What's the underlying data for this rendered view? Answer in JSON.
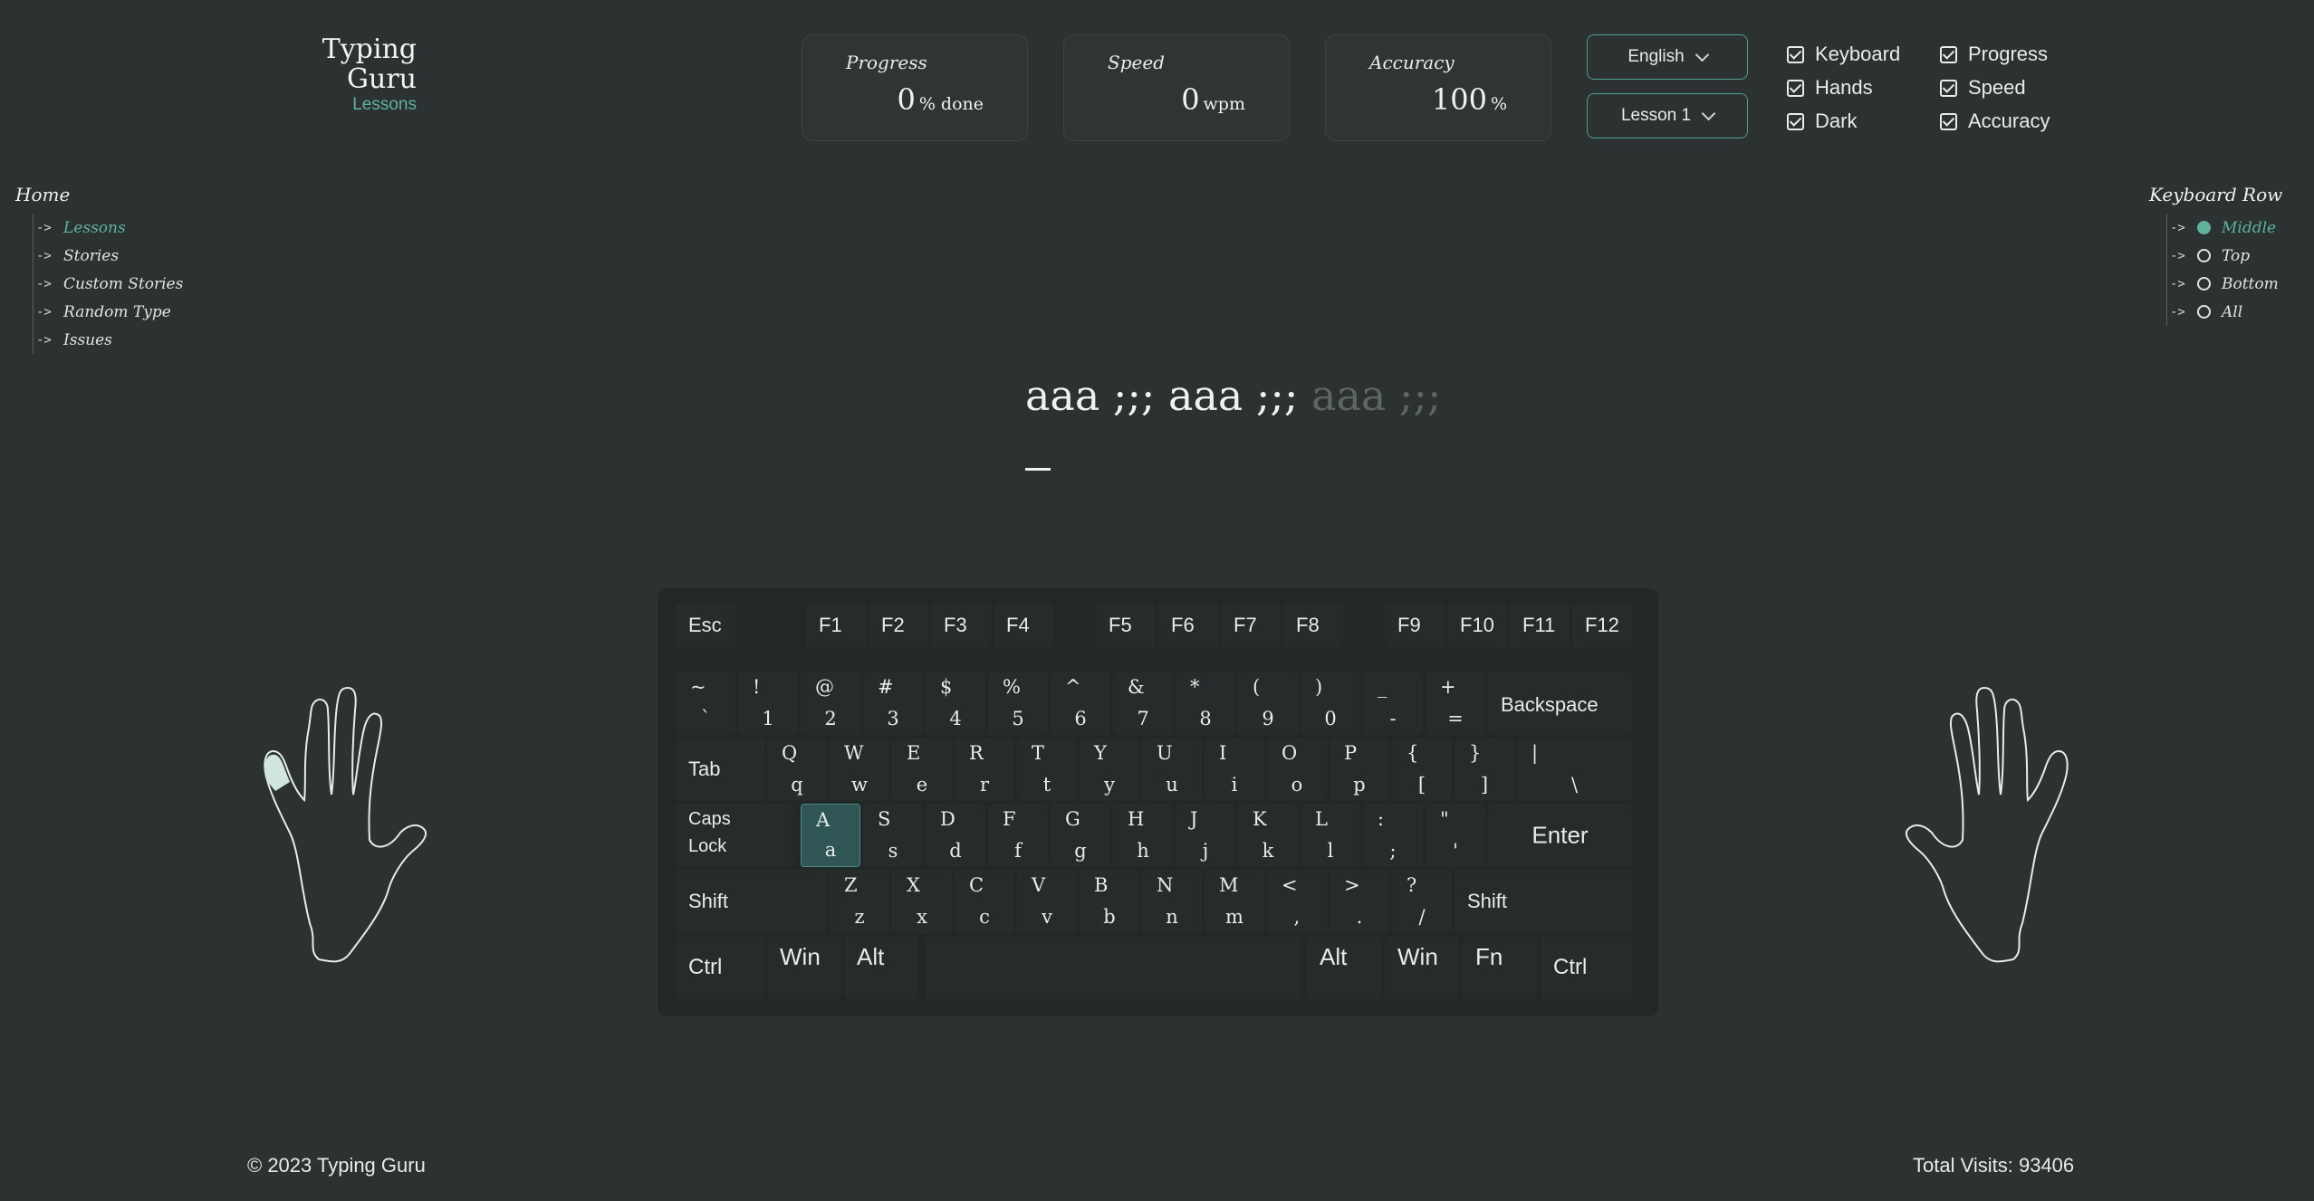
{
  "brand": {
    "title": "Typing Guru",
    "subtitle": "Lessons"
  },
  "stats": [
    {
      "label": "Progress",
      "value": "0",
      "unit": "% done"
    },
    {
      "label": "Speed",
      "value": "0",
      "unit": "wpm"
    },
    {
      "label": "Accuracy",
      "value": "100",
      "unit": "%"
    }
  ],
  "selects": {
    "language": "English",
    "lesson": "Lesson 1"
  },
  "toggles": [
    {
      "label": "Keyboard",
      "checked": true
    },
    {
      "label": "Progress",
      "checked": true
    },
    {
      "label": "Hands",
      "checked": true
    },
    {
      "label": "Speed",
      "checked": true
    },
    {
      "label": "Dark",
      "checked": true
    },
    {
      "label": "Accuracy",
      "checked": true
    }
  ],
  "nav": {
    "title": "Home",
    "items": [
      "Lessons",
      "Stories",
      "Custom Stories",
      "Random Type",
      "Issues"
    ],
    "active": "Lessons"
  },
  "row_nav": {
    "title": "Keyboard Row",
    "items": [
      "Middle",
      "Top",
      "Bottom",
      "All"
    ],
    "selected": "Middle"
  },
  "typing": {
    "typed": "aaa ;;; aaa ;;; ",
    "pending": "aaa ;;;"
  },
  "keyboard": {
    "function_row": [
      "Esc",
      "F1",
      "F2",
      "F3",
      "F4",
      "F5",
      "F6",
      "F7",
      "F8",
      "F9",
      "F10",
      "F11",
      "F12"
    ],
    "number_row": [
      [
        "~",
        "`"
      ],
      [
        "!",
        "1"
      ],
      [
        "@",
        "2"
      ],
      [
        "#",
        "3"
      ],
      [
        "$",
        "4"
      ],
      [
        "%",
        "5"
      ],
      [
        "^",
        "6"
      ],
      [
        "&",
        "7"
      ],
      [
        "*",
        "8"
      ],
      [
        "(",
        "9"
      ],
      [
        ")",
        "0"
      ],
      [
        "_",
        "-"
      ],
      [
        "+",
        "="
      ]
    ],
    "backspace": "Backspace",
    "tab": "Tab",
    "top_row": [
      [
        "Q",
        "q"
      ],
      [
        "W",
        "w"
      ],
      [
        "E",
        "e"
      ],
      [
        "R",
        "r"
      ],
      [
        "T",
        "t"
      ],
      [
        "Y",
        "y"
      ],
      [
        "U",
        "u"
      ],
      [
        "I",
        "i"
      ],
      [
        "O",
        "o"
      ],
      [
        "P",
        "p"
      ],
      [
        "{",
        "["
      ],
      [
        "}",
        "]"
      ],
      [
        "|",
        "\\"
      ]
    ],
    "caps": [
      "Caps",
      "Lock"
    ],
    "home_row": [
      [
        "A",
        "a"
      ],
      [
        "S",
        "s"
      ],
      [
        "D",
        "d"
      ],
      [
        "F",
        "f"
      ],
      [
        "G",
        "g"
      ],
      [
        "H",
        "h"
      ],
      [
        "J",
        "j"
      ],
      [
        "K",
        "k"
      ],
      [
        "L",
        "l"
      ],
      [
        ":",
        ";"
      ],
      [
        "\"",
        "'"
      ]
    ],
    "enter": "Enter",
    "shift": "Shift",
    "bottom_row": [
      [
        "Z",
        "z"
      ],
      [
        "X",
        "x"
      ],
      [
        "C",
        "c"
      ],
      [
        "V",
        "v"
      ],
      [
        "B",
        "b"
      ],
      [
        "N",
        "n"
      ],
      [
        "M",
        "m"
      ],
      [
        "<",
        ","
      ],
      [
        ">",
        "."
      ],
      [
        "?",
        "/"
      ]
    ],
    "space_row": [
      "Ctrl",
      "Win",
      "Alt",
      "",
      "Alt",
      "Win",
      "Fn",
      "Ctrl"
    ],
    "highlighted_key": "A",
    "highlight_color": "#2f5654"
  },
  "hands": {
    "active_finger": "left-pinky",
    "finger_color": "#cfe5dd"
  },
  "footer": {
    "copyright": "© 2023 Typing Guru",
    "visits": "Total Visits: 93406"
  },
  "colors": {
    "background": "#2b3231",
    "accent": "#5fb29c",
    "keyboard": "#222827"
  }
}
